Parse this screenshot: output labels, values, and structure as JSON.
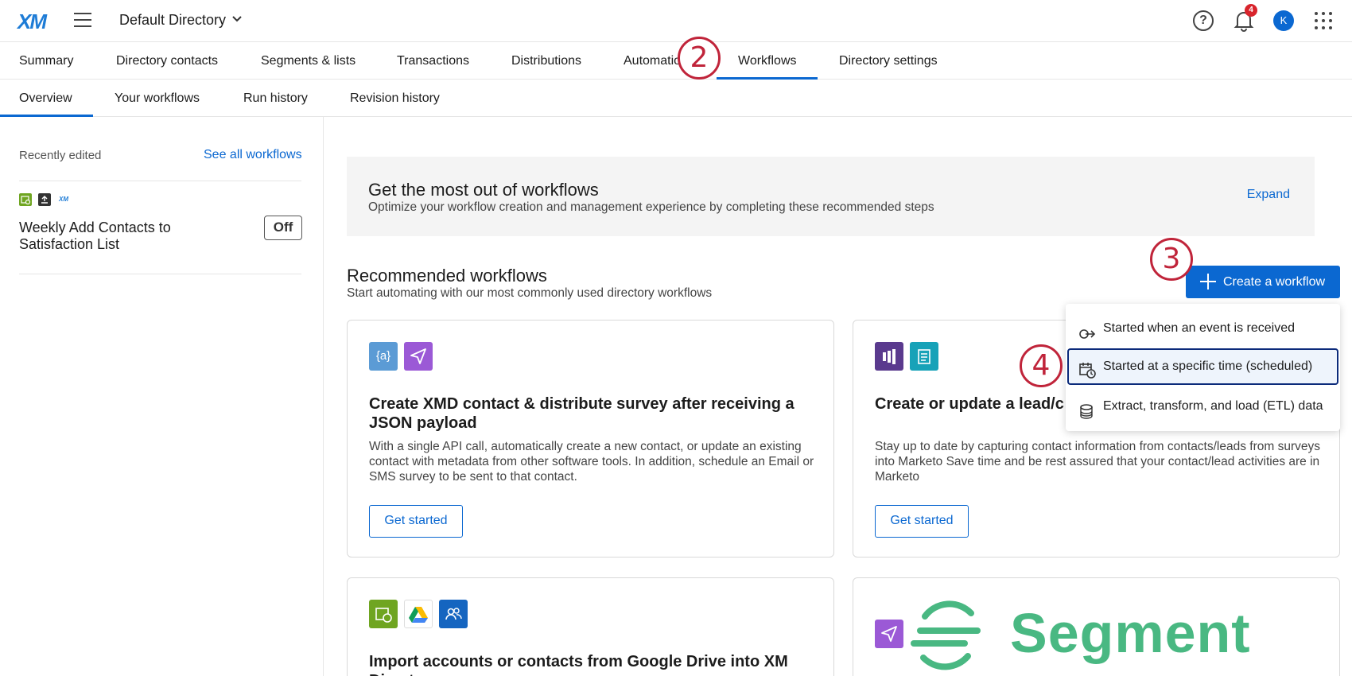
{
  "app": {
    "logo": "XM",
    "directory_title": "Default Directory",
    "notification_count": "4",
    "avatar_initial": "K"
  },
  "nav_primary": [
    {
      "label": "Summary"
    },
    {
      "label": "Directory contacts"
    },
    {
      "label": "Segments & lists"
    },
    {
      "label": "Transactions"
    },
    {
      "label": "Distributions"
    },
    {
      "label": "Automatio"
    },
    {
      "label": "Workflows"
    },
    {
      "label": "Directory settings"
    }
  ],
  "nav_secondary": [
    {
      "label": "Overview"
    },
    {
      "label": "Your workflows"
    },
    {
      "label": "Run history"
    },
    {
      "label": "Revision history"
    }
  ],
  "sidebar": {
    "recent_label": "Recently edited",
    "see_all": "See all workflows",
    "workflow_name": "Weekly Add Contacts to Satisfaction List",
    "workflow_toggle": "Off",
    "mini_icon_xm": "XM"
  },
  "banner": {
    "title": "Get the most out of workflows",
    "subtitle": "Optimize your workflow creation and management experience by completing these recommended steps",
    "expand": "Expand"
  },
  "recommended": {
    "title": "Recommended workflows",
    "subtitle": "Start automating with our most commonly used directory workflows",
    "create_button": "Create a workflow"
  },
  "cards": [
    {
      "title": "Create XMD contact & distribute survey after receiving a JSON payload",
      "description": "With a single API call, automatically create a new contact, or update an existing contact with metadata from other software tools. In addition, schedule an Email or SMS survey to be sent to that contact.",
      "button": "Get started",
      "icon_text": "{a}"
    },
    {
      "title": "Create or update a lead/c single activity",
      "description": "Stay up to date by capturing contact information from contacts/leads from surveys into Marketo Save time and be rest assured that your contact/lead activities are in Marketo",
      "button": "Get started"
    },
    {
      "title": "Import accounts or contacts from Google Drive into XM Directory"
    },
    {
      "brand": "Segment"
    }
  ],
  "dropdown": [
    {
      "label": "Started when an event is received"
    },
    {
      "label": "Started at a specific time (scheduled)"
    },
    {
      "label": "Extract, transform, and load (ETL) data"
    }
  ],
  "steps": {
    "two": "2",
    "three": "3",
    "four": "4"
  },
  "colors": {
    "accent": "#0b68d1",
    "step_marker": "#c0243a",
    "segment_green": "#49b882"
  }
}
